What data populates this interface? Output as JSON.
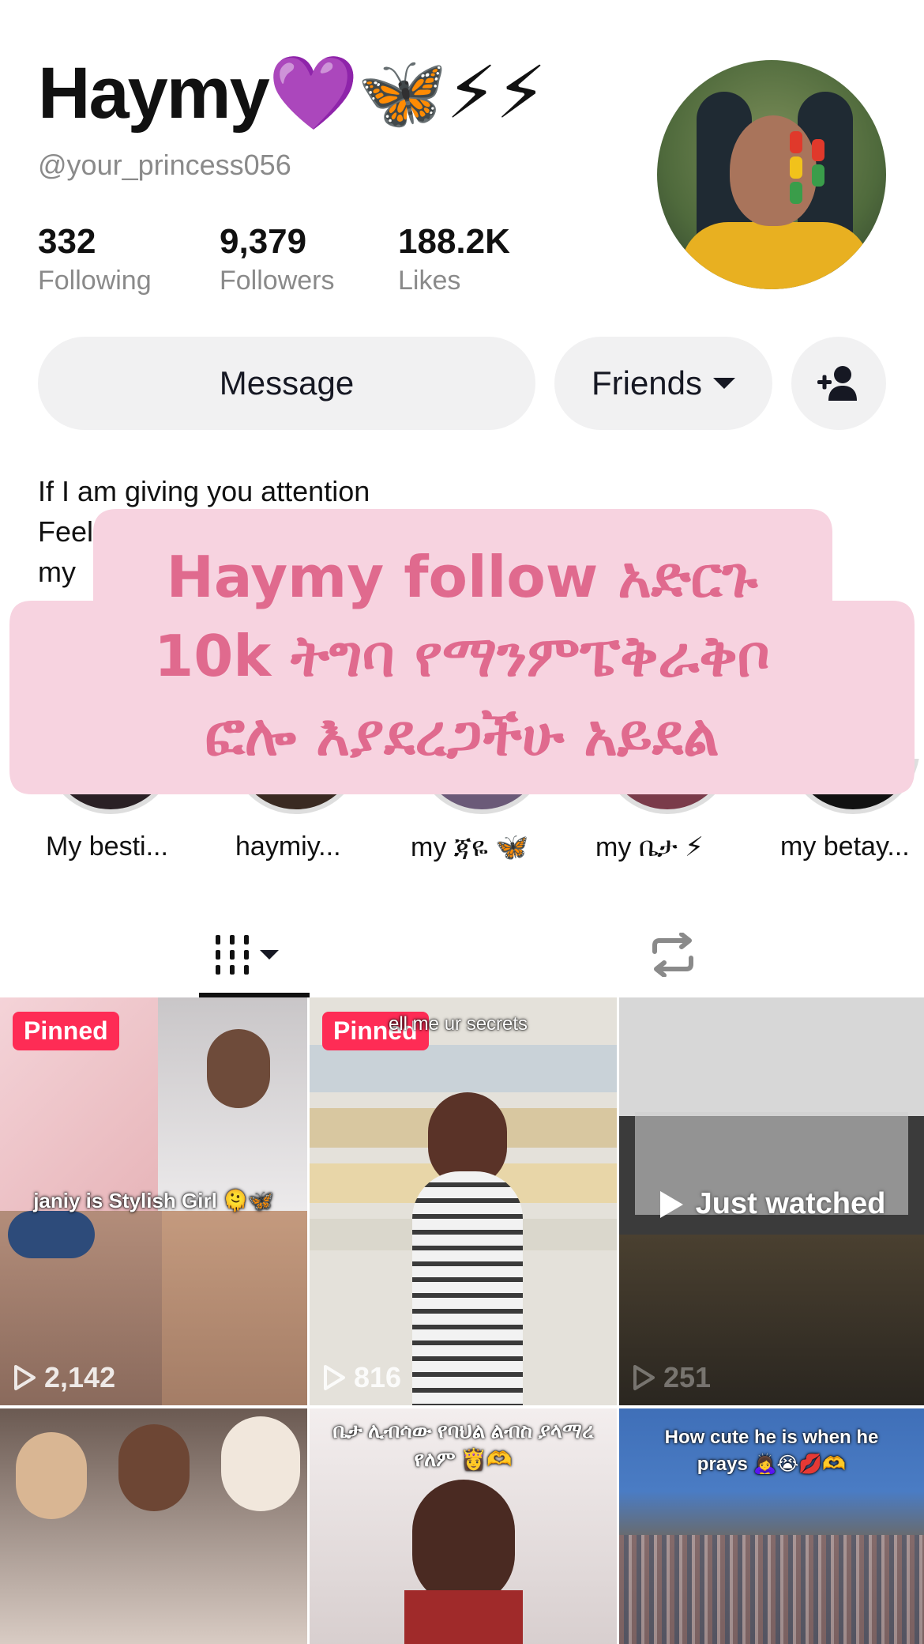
{
  "profile": {
    "display_name": "Haymy💜🦋⚡⚡",
    "handle": "@your_princess056"
  },
  "stats": [
    {
      "value": "332",
      "label": "Following"
    },
    {
      "value": "9,379",
      "label": "Followers"
    },
    {
      "value": "188.2K",
      "label": "Likes"
    }
  ],
  "actions": {
    "message_label": "Message",
    "friends_label": "Friends"
  },
  "bio": "If I am giving you attention\nFeel\nmy",
  "overlay_text": "Haymy follow አድርጉ\n10k ትግባ የማንምፔቅራቅቦ\nፎሎ እያደረጋችሁ አይደል",
  "highlights": [
    {
      "label": "My besti..."
    },
    {
      "label": "haymiy..."
    },
    {
      "label": "my ጃዬ 🦋"
    },
    {
      "label": "my ቤታ ⚡"
    },
    {
      "label": "my betay..."
    }
  ],
  "videos": [
    {
      "pinned_label": "Pinned",
      "caption": "janiy is Stylish Girl 🫠🦋",
      "views": "2,142"
    },
    {
      "pinned_label": "Pinned",
      "caption": "ell me ur secrets",
      "views": "816"
    },
    {
      "status": "Just watched",
      "views": "251"
    },
    {
      "caption": ""
    },
    {
      "caption": "ቤታ ሊብሳው የባህል ልብስ ያላማረ\nየለም 👸🫶"
    },
    {
      "caption": "How cute he is when he\nprays 🙇‍♀️😭💋🫶"
    }
  ],
  "colors": {
    "accent": "#fe2c55",
    "overlay_bg": "#f7d3e0",
    "overlay_text": "#e06a8e",
    "button_bg": "#f1f1f2"
  }
}
